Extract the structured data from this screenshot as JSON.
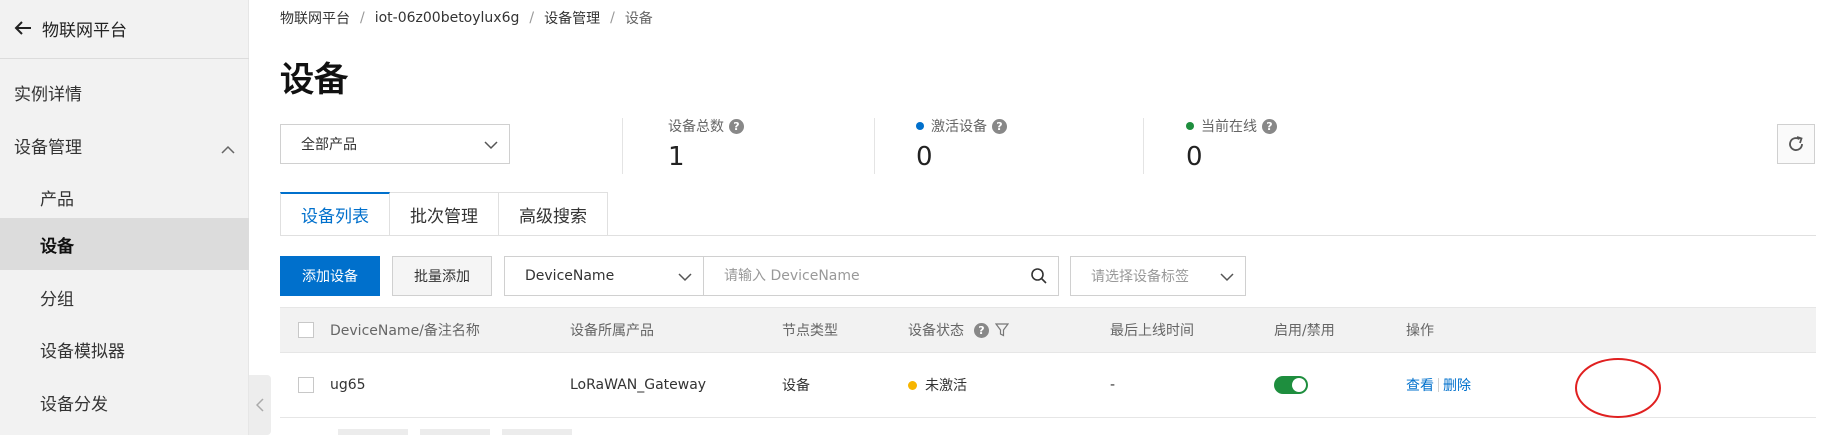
{
  "sidebar": {
    "back_label": "物联网平台",
    "items": [
      {
        "label": "实例详情"
      },
      {
        "label": "设备管理"
      },
      {
        "label": "产品"
      },
      {
        "label": "设备"
      },
      {
        "label": "分组"
      },
      {
        "label": "设备模拟器"
      },
      {
        "label": "设备分发"
      }
    ]
  },
  "breadcrumb": [
    "物联网平台",
    "iot-06z00betoylux6g",
    "设备管理",
    "设备"
  ],
  "page_title": "设备",
  "product_select": {
    "value": "全部产品"
  },
  "stats": [
    {
      "label": "设备总数",
      "value": "1"
    },
    {
      "label": "激活设备",
      "value": "0",
      "dot_color": "#0070cc"
    },
    {
      "label": "当前在线",
      "value": "0",
      "dot_color": "#1e8e3e"
    }
  ],
  "tabs": [
    "设备列表",
    "批次管理",
    "高级搜索"
  ],
  "toolbar": {
    "add_device": "添加设备",
    "batch_add": "批量添加",
    "field_select": "DeviceName",
    "search_placeholder": "请输入 DeviceName",
    "tag_placeholder": "请选择设备标签"
  },
  "table": {
    "headers": [
      "DeviceName/备注名称",
      "设备所属产品",
      "节点类型",
      "设备状态",
      "最后上线时间",
      "启用/禁用",
      "操作"
    ],
    "rows": [
      {
        "device_name": "ug65",
        "product": "LoRaWAN_Gateway",
        "node_type": "设备",
        "status": "未激活",
        "last_online": "-",
        "enabled": true,
        "actions": [
          "查看",
          "删除"
        ]
      }
    ]
  },
  "colors": {
    "primary": "#0070cc",
    "status_inactive": "#f7b500",
    "toggle_on": "#1e8e3e",
    "annotation": "#e02020"
  }
}
